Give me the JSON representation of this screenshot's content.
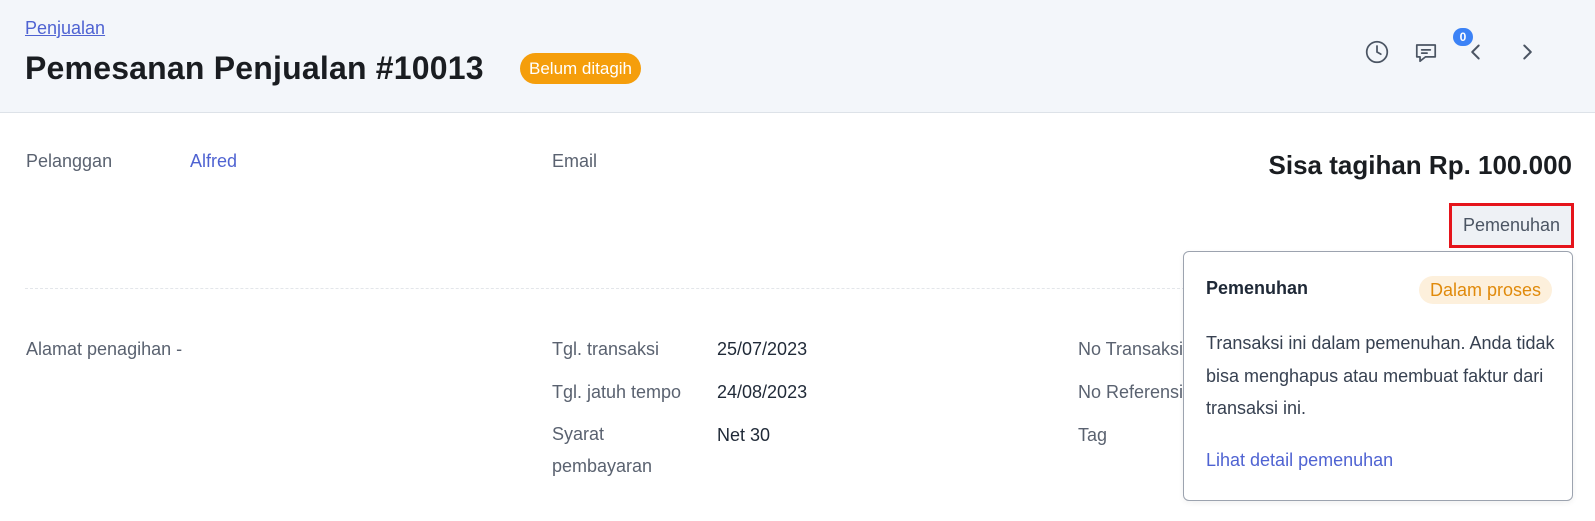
{
  "header": {
    "breadcrumb": "Penjualan",
    "title": "Pemesanan Penjualan #10013",
    "status": "Belum ditagih",
    "notification_count": "0",
    "icons": [
      "history-icon",
      "comment-icon",
      "chevron-left-icon",
      "chevron-right-icon"
    ]
  },
  "customer": {
    "label": "Pelanggan",
    "value": "Alfred",
    "email_label": "Email"
  },
  "balance": "Sisa tagihan Rp. 100.000",
  "fulfillment_button": "Pemenuhan",
  "billing": {
    "label": "Alamat penagihan",
    "value": "-"
  },
  "details": {
    "transaction_date_label": "Tgl. transaksi",
    "transaction_date": "25/07/2023",
    "due_date_label": "Tgl. jatuh tempo",
    "due_date": "24/08/2023",
    "payment_terms_label": "Syarat pembayaran",
    "payment_terms": "Net 30",
    "transaction_no_label": "No Transaksi",
    "reference_no_label": "No Referensi",
    "tag_label": "Tag"
  },
  "popover": {
    "title": "Pemenuhan",
    "badge": "Dalam proses",
    "text": "Transaksi ini dalam pemenuhan. Anda tidak bisa menghapus atau membuat faktur dari transaksi ini.",
    "link": "Lihat detail pemenuhan"
  },
  "colors": {
    "accent": "#4f63d2",
    "status_badge": "#f59e0b",
    "highlight_border": "#e5141b",
    "notification": "#3b82f6"
  }
}
